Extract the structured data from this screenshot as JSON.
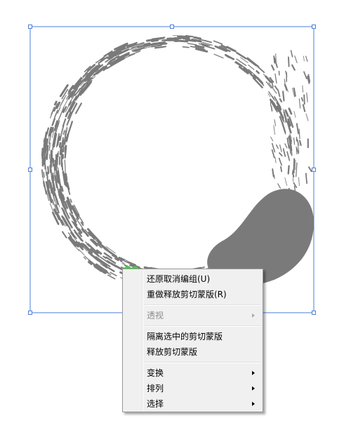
{
  "colors": {
    "selection": "#4a7fd9",
    "ink": "#7a7a7a",
    "highlight": "#3fd13f",
    "menu_bg": "#f0f0f0"
  },
  "context_menu": {
    "groups": [
      [
        {
          "label": "还原取消编组(U)",
          "enabled": true,
          "submenu": false
        },
        {
          "label": "重做释放剪切蒙版(R)",
          "enabled": true,
          "submenu": false
        }
      ],
      [
        {
          "label": "透视",
          "enabled": false,
          "submenu": true
        }
      ],
      [
        {
          "label": "隔离选中的剪切蒙版",
          "enabled": true,
          "submenu": false
        },
        {
          "label": "释放剪切蒙版",
          "enabled": true,
          "submenu": false
        }
      ],
      [
        {
          "label": "变换",
          "enabled": true,
          "submenu": true
        },
        {
          "label": "排列",
          "enabled": true,
          "submenu": true
        },
        {
          "label": "选择",
          "enabled": true,
          "submenu": true
        }
      ]
    ]
  }
}
